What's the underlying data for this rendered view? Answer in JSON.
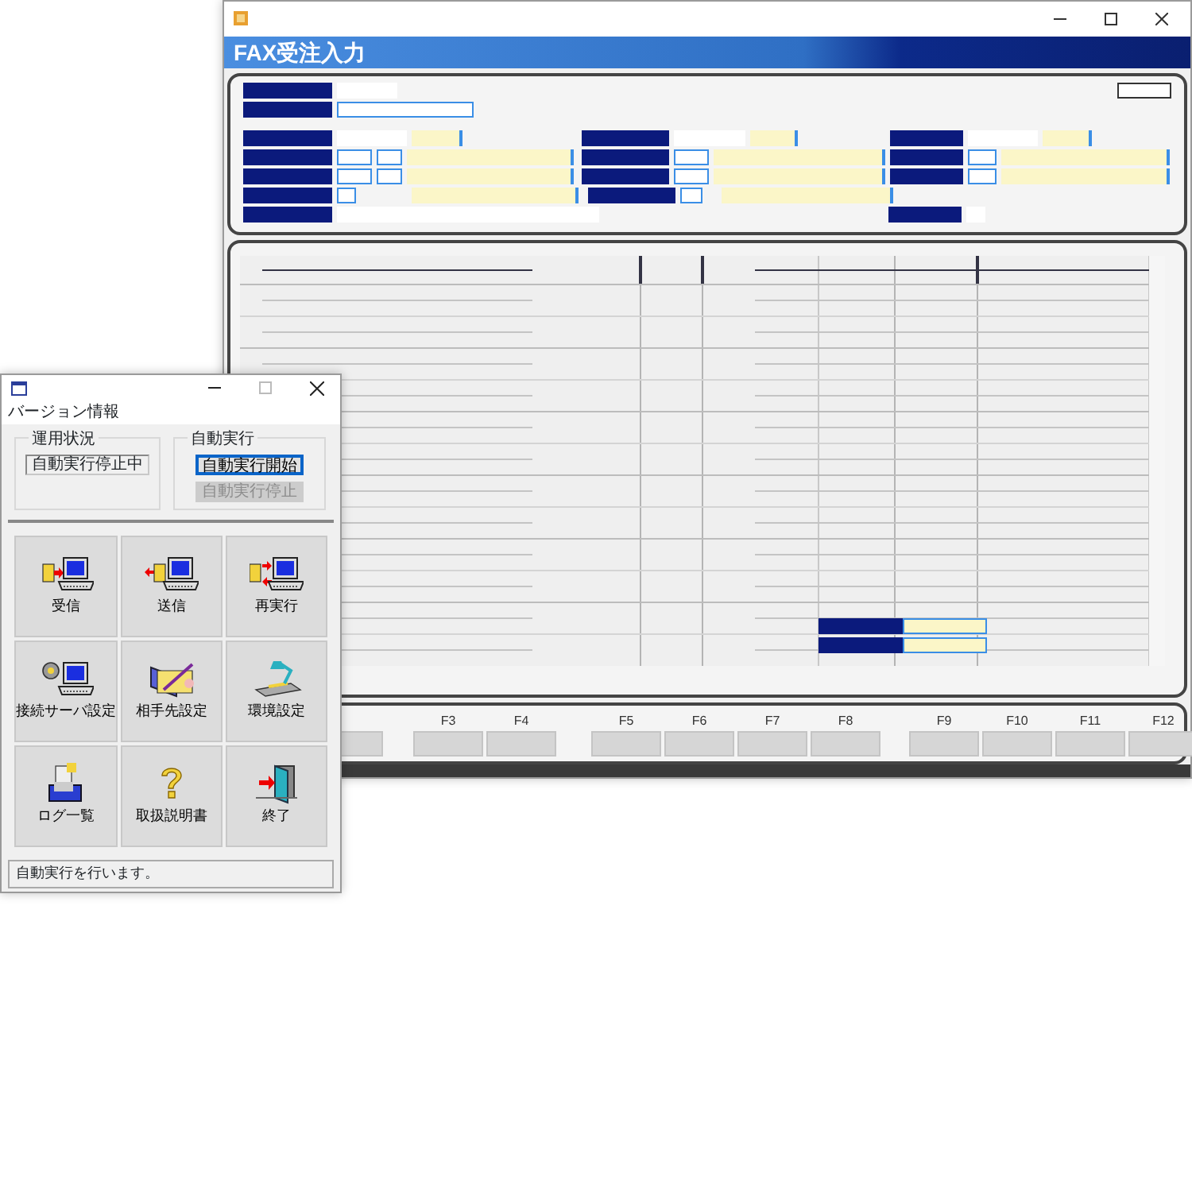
{
  "order_window": {
    "header_title": "FAX受注入力",
    "function_keys": [
      {
        "key": "F3"
      },
      {
        "key": "F4"
      },
      {
        "key": "F5"
      },
      {
        "key": "F6"
      },
      {
        "key": "F7"
      },
      {
        "key": "F8"
      },
      {
        "key": "F9"
      },
      {
        "key": "F10"
      },
      {
        "key": "F11"
      },
      {
        "key": "F12"
      }
    ]
  },
  "launcher_window": {
    "menu": [
      "バージョン情報"
    ],
    "status_group": {
      "title": "運用状況",
      "value": "自動実行停止中"
    },
    "auto_group": {
      "title": "自動実行",
      "buttons": [
        {
          "label": "自動実行開始",
          "disabled": false,
          "focused": true
        },
        {
          "label": "自動実行停止",
          "disabled": true,
          "focused": false
        }
      ]
    },
    "tiles": [
      {
        "label": "受信",
        "kind": "receive"
      },
      {
        "label": "送信",
        "kind": "send"
      },
      {
        "label": "再実行",
        "kind": "retry"
      },
      {
        "label": "接続サーバ設定",
        "kind": "server"
      },
      {
        "label": "相手先設定",
        "kind": "partner"
      },
      {
        "label": "環境設定",
        "kind": "environment"
      },
      {
        "label": "ログ一覧",
        "kind": "log"
      },
      {
        "label": "取扱説明書",
        "kind": "manual"
      },
      {
        "label": "終了",
        "kind": "exit"
      }
    ],
    "status_bar": "自動実行を行います。"
  }
}
